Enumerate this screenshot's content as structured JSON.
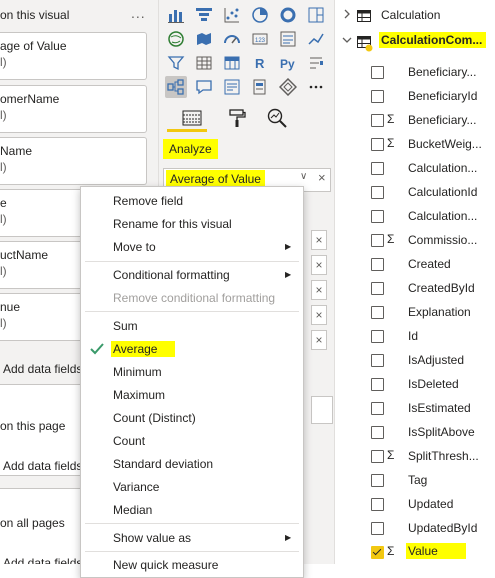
{
  "filters": {
    "header": "on this visual",
    "more": "...",
    "cards": [
      {
        "title": "age of Value",
        "sub": "l)"
      },
      {
        "title": "omerName",
        "sub": "l)"
      },
      {
        "title": "Name",
        "sub": "l)"
      },
      {
        "title": "e",
        "sub": "l)"
      },
      {
        "title": "uctName",
        "sub": "l)"
      },
      {
        "title": "nue",
        "sub": "l)"
      }
    ],
    "add_fields": "Add data fields",
    "add_fields_cut": "Add data fields",
    "add_fields_cut2": "Add data fields",
    "on_page": "on this page",
    "all_pages": "on all pages"
  },
  "viz": {
    "analyze": "Analyze",
    "well_value": "Average of Value",
    "well_chevron": "∨",
    "well_close": "×",
    "mini_close": "×",
    "tabs": [
      "build-visual-tab",
      "format-visual-tab",
      "analytics-tab"
    ]
  },
  "menu": {
    "items": [
      {
        "label": "Remove field",
        "state": "normal"
      },
      {
        "label": "Rename for this visual",
        "state": "normal"
      },
      {
        "label": "Move to",
        "state": "submenu"
      },
      {
        "label": "Conditional formatting",
        "state": "submenu"
      },
      {
        "label": "Remove conditional formatting",
        "state": "disabled"
      },
      {
        "label": "Sum",
        "state": "normal"
      },
      {
        "label": "Average",
        "state": "checked"
      },
      {
        "label": "Minimum",
        "state": "normal"
      },
      {
        "label": "Maximum",
        "state": "normal"
      },
      {
        "label": "Count (Distinct)",
        "state": "normal"
      },
      {
        "label": "Count",
        "state": "normal"
      },
      {
        "label": "Standard deviation",
        "state": "normal"
      },
      {
        "label": "Variance",
        "state": "normal"
      },
      {
        "label": "Median",
        "state": "normal"
      },
      {
        "label": "Show value as",
        "state": "submenu"
      },
      {
        "label": "New quick measure",
        "state": "normal"
      }
    ],
    "submenu_arrow": "▶"
  },
  "fields": {
    "tables": [
      {
        "name": "Calculation",
        "caret": "collapsed"
      },
      {
        "name": "CalculationCom...",
        "caret": "expanded"
      }
    ],
    "items": [
      {
        "name": "Beneficiary...",
        "sigma": false,
        "checked": false
      },
      {
        "name": "BeneficiaryId",
        "sigma": false,
        "checked": false
      },
      {
        "name": "Beneficiary...",
        "sigma": true,
        "checked": false
      },
      {
        "name": "BucketWeig...",
        "sigma": true,
        "checked": false
      },
      {
        "name": "Calculation...",
        "sigma": false,
        "checked": false
      },
      {
        "name": "CalculationId",
        "sigma": false,
        "checked": false
      },
      {
        "name": "Calculation...",
        "sigma": false,
        "checked": false
      },
      {
        "name": "Commissio...",
        "sigma": true,
        "checked": false
      },
      {
        "name": "Created",
        "sigma": false,
        "checked": false
      },
      {
        "name": "CreatedById",
        "sigma": false,
        "checked": false
      },
      {
        "name": "Explanation",
        "sigma": false,
        "checked": false
      },
      {
        "name": "Id",
        "sigma": false,
        "checked": false
      },
      {
        "name": "IsAdjusted",
        "sigma": false,
        "checked": false
      },
      {
        "name": "IsDeleted",
        "sigma": false,
        "checked": false
      },
      {
        "name": "IsEstimated",
        "sigma": false,
        "checked": false
      },
      {
        "name": "IsSplitAbove",
        "sigma": false,
        "checked": false
      },
      {
        "name": "SplitThresh...",
        "sigma": true,
        "checked": false
      },
      {
        "name": "Tag",
        "sigma": false,
        "checked": false
      },
      {
        "name": "Updated",
        "sigma": false,
        "checked": false
      },
      {
        "name": "UpdatedById",
        "sigma": false,
        "checked": false
      },
      {
        "name": "Value",
        "sigma": true,
        "checked": true
      }
    ],
    "sigma_glyph": "Σ"
  },
  "colors": {
    "highlight": "#ffff00",
    "accent": "#f2c811",
    "checkmark": "#3a9a6a"
  }
}
